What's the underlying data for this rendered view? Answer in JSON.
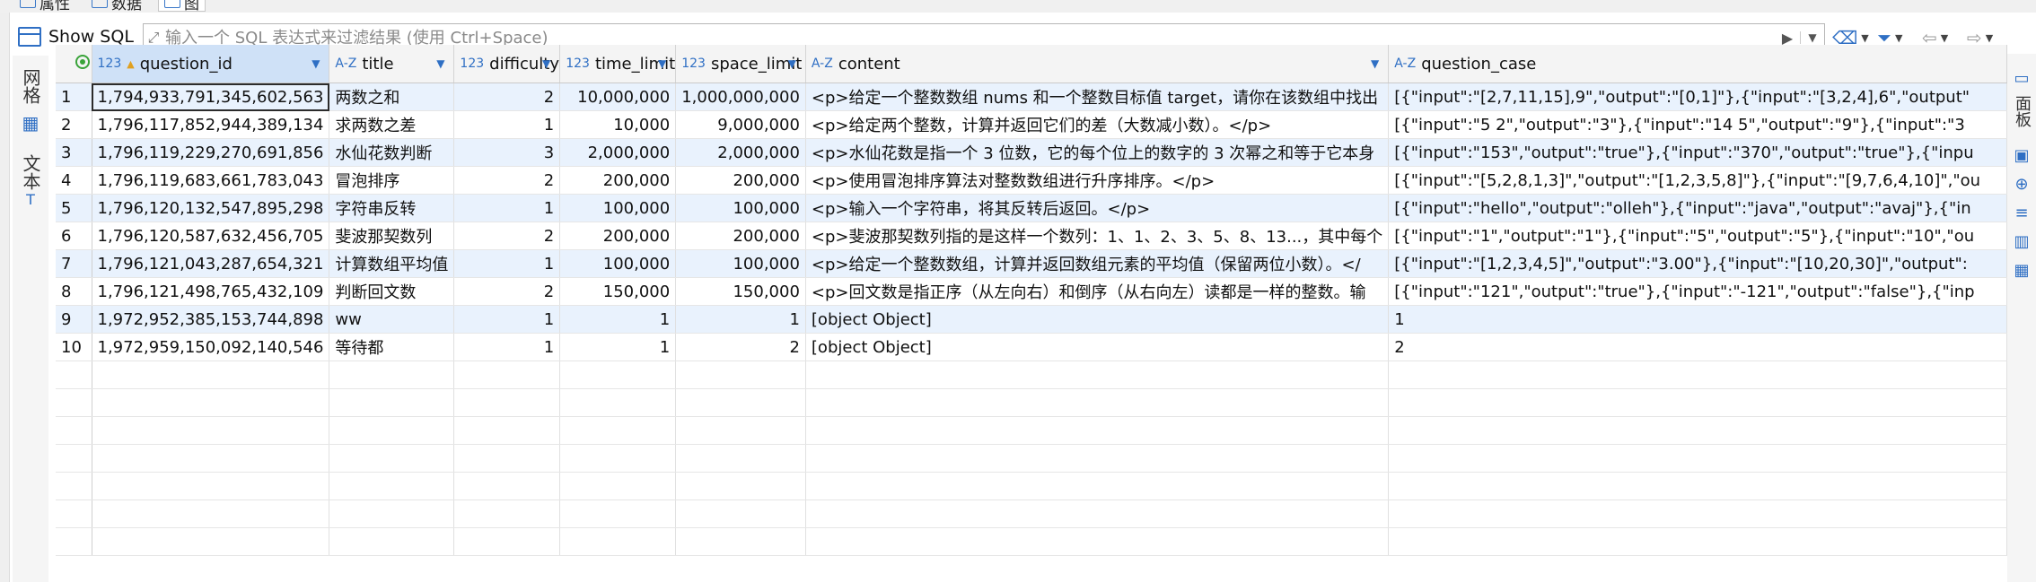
{
  "tabs": [
    {
      "label": "属性"
    },
    {
      "label": "数据"
    },
    {
      "label": "图"
    }
  ],
  "filter": {
    "show_sql_label": "Show SQL",
    "placeholder": "输入一个 SQL 表达式来过滤结果 (使用 Ctrl+Space)"
  },
  "left_tabs": {
    "grid_label": "网格",
    "text_label": "文本"
  },
  "right_tabs": {
    "panel_label": "面板"
  },
  "columns": [
    {
      "type": "123",
      "name": "question_id",
      "key": true
    },
    {
      "type": "A-Z",
      "name": "title"
    },
    {
      "type": "123",
      "name": "difficulty"
    },
    {
      "type": "123",
      "name": "time_limit"
    },
    {
      "type": "123",
      "name": "space_limit"
    },
    {
      "type": "A-Z",
      "name": "content"
    },
    {
      "type": "A-Z",
      "name": "question_case"
    }
  ],
  "rows": [
    {
      "n": "1",
      "question_id": "1,794,933,791,345,602,563",
      "title": "两数之和",
      "difficulty": "2",
      "time_limit": "10,000,000",
      "space_limit": "1,000,000,000",
      "content": "<p>给定一个整数数组 nums 和一个整数目标值 target，请你在该数组中找出",
      "question_case": "[{\"input\":\"[2,7,11,15],9\",\"output\":\"[0,1]\"},{\"input\":\"[3,2,4],6\",\"output\""
    },
    {
      "n": "2",
      "question_id": "1,796,117,852,944,389,134",
      "title": "求两数之差",
      "difficulty": "1",
      "time_limit": "10,000",
      "space_limit": "9,000,000",
      "content": "<p>给定两个整数，计算并返回它们的差（大数减小数）。</p>",
      "question_case": "[{\"input\":\"5 2\",\"output\":\"3\"},{\"input\":\"14 5\",\"output\":\"9\"},{\"input\":\"3"
    },
    {
      "n": "3",
      "question_id": "1,796,119,229,270,691,856",
      "title": "水仙花数判断",
      "difficulty": "3",
      "time_limit": "2,000,000",
      "space_limit": "2,000,000",
      "content": "<p>水仙花数是指一个 3 位数，它的每个位上的数字的 3 次幂之和等于它本身",
      "question_case": "[{\"input\":\"153\",\"output\":\"true\"},{\"input\":\"370\",\"output\":\"true\"},{\"inpu"
    },
    {
      "n": "4",
      "question_id": "1,796,119,683,661,783,043",
      "title": "冒泡排序",
      "difficulty": "2",
      "time_limit": "200,000",
      "space_limit": "200,000",
      "content": "<p>使用冒泡排序算法对整数数组进行升序排序。</p>",
      "question_case": "[{\"input\":\"[5,2,8,1,3]\",\"output\":\"[1,2,3,5,8]\"},{\"input\":\"[9,7,6,4,10]\",\"ou"
    },
    {
      "n": "5",
      "question_id": "1,796,120,132,547,895,298",
      "title": "字符串反转",
      "difficulty": "1",
      "time_limit": "100,000",
      "space_limit": "100,000",
      "content": "<p>输入一个字符串，将其反转后返回。</p>",
      "question_case": "[{\"input\":\"hello\",\"output\":\"olleh\"},{\"input\":\"java\",\"output\":\"avaj\"},{\"in"
    },
    {
      "n": "6",
      "question_id": "1,796,120,587,632,456,705",
      "title": "斐波那契数列",
      "difficulty": "2",
      "time_limit": "200,000",
      "space_limit": "200,000",
      "content": "<p>斐波那契数列指的是这样一个数列：1、1、2、3、5、8、13...，其中每个",
      "question_case": "[{\"input\":\"1\",\"output\":\"1\"},{\"input\":\"5\",\"output\":\"5\"},{\"input\":\"10\",\"ou"
    },
    {
      "n": "7",
      "question_id": "1,796,121,043,287,654,321",
      "title": "计算数组平均值",
      "difficulty": "1",
      "time_limit": "100,000",
      "space_limit": "100,000",
      "content": "<p>给定一个整数数组，计算并返回数组元素的平均值（保留两位小数）。</",
      "question_case": "[{\"input\":\"[1,2,3,4,5]\",\"output\":\"3.00\"},{\"input\":\"[10,20,30]\",\"output\":"
    },
    {
      "n": "8",
      "question_id": "1,796,121,498,765,432,109",
      "title": "判断回文数",
      "difficulty": "2",
      "time_limit": "150,000",
      "space_limit": "150,000",
      "content": "<p>回文数是指正序（从左向右）和倒序（从右向左）读都是一样的整数。输",
      "question_case": "[{\"input\":\"121\",\"output\":\"true\"},{\"input\":\"-121\",\"output\":\"false\"},{\"inp"
    },
    {
      "n": "9",
      "question_id": "1,972,952,385,153,744,898",
      "title": "ww",
      "difficulty": "1",
      "time_limit": "1",
      "space_limit": "1",
      "content": "[object Object]",
      "question_case": "1"
    },
    {
      "n": "10",
      "question_id": "1,972,959,150,092,140,546",
      "title": "等待都",
      "difficulty": "1",
      "time_limit": "1",
      "space_limit": "2",
      "content": "[object Object]",
      "question_case": "2"
    }
  ],
  "colors": {
    "accent": "#2f6fc4",
    "row_alt": "#e9f2fd",
    "header_selected": "#cfe1f7"
  }
}
